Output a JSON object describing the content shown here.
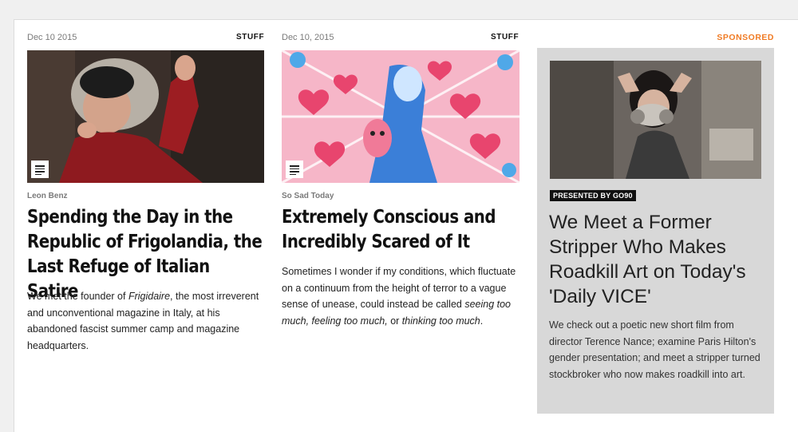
{
  "articles": [
    {
      "date": "Dec 10 2015",
      "tag": "STUFF",
      "author": "Leon Benz",
      "headline": "Spending the Day in the Republic of Frigolandia, the Last Refuge of Italian Satire",
      "dek_parts": [
        "We met the founder of ",
        "Frigidaire",
        ", the most irreverent and unconventional magazine in Italy, at his abandoned fascist summer camp and magazine headquarters."
      ],
      "image_icon": "article-doc-icon"
    },
    {
      "date": "Dec 10, 2015",
      "tag": "STUFF",
      "author": "So Sad Today",
      "headline": "Extremely Conscious and Incredibly Scared of It",
      "dek_parts": [
        "Sometimes I wonder if my conditions, which fluctuate on a continuum from the height of terror to a vague sense of unease, could instead be called ",
        "seeing too much, feeling too much,",
        " or ",
        "thinking too much",
        "."
      ],
      "image_icon": "article-doc-icon"
    }
  ],
  "sponsored": {
    "label": "SPONSORED",
    "presented_by": "PRESENTED BY GO90",
    "headline": "We Meet a Former Stripper Who Makes Roadkill Art on Today's 'Daily VICE'",
    "dek": "We check out a poetic new short film from director Terence Nance; examine Paris Hilton's gender presentation; and meet a stripper turned stockbroker who now makes roadkill into art."
  },
  "colors": {
    "sponsored_accent": "#f07b24",
    "sponsor_box": "#d8d8d8",
    "page_bg": "#f0f0f0"
  }
}
